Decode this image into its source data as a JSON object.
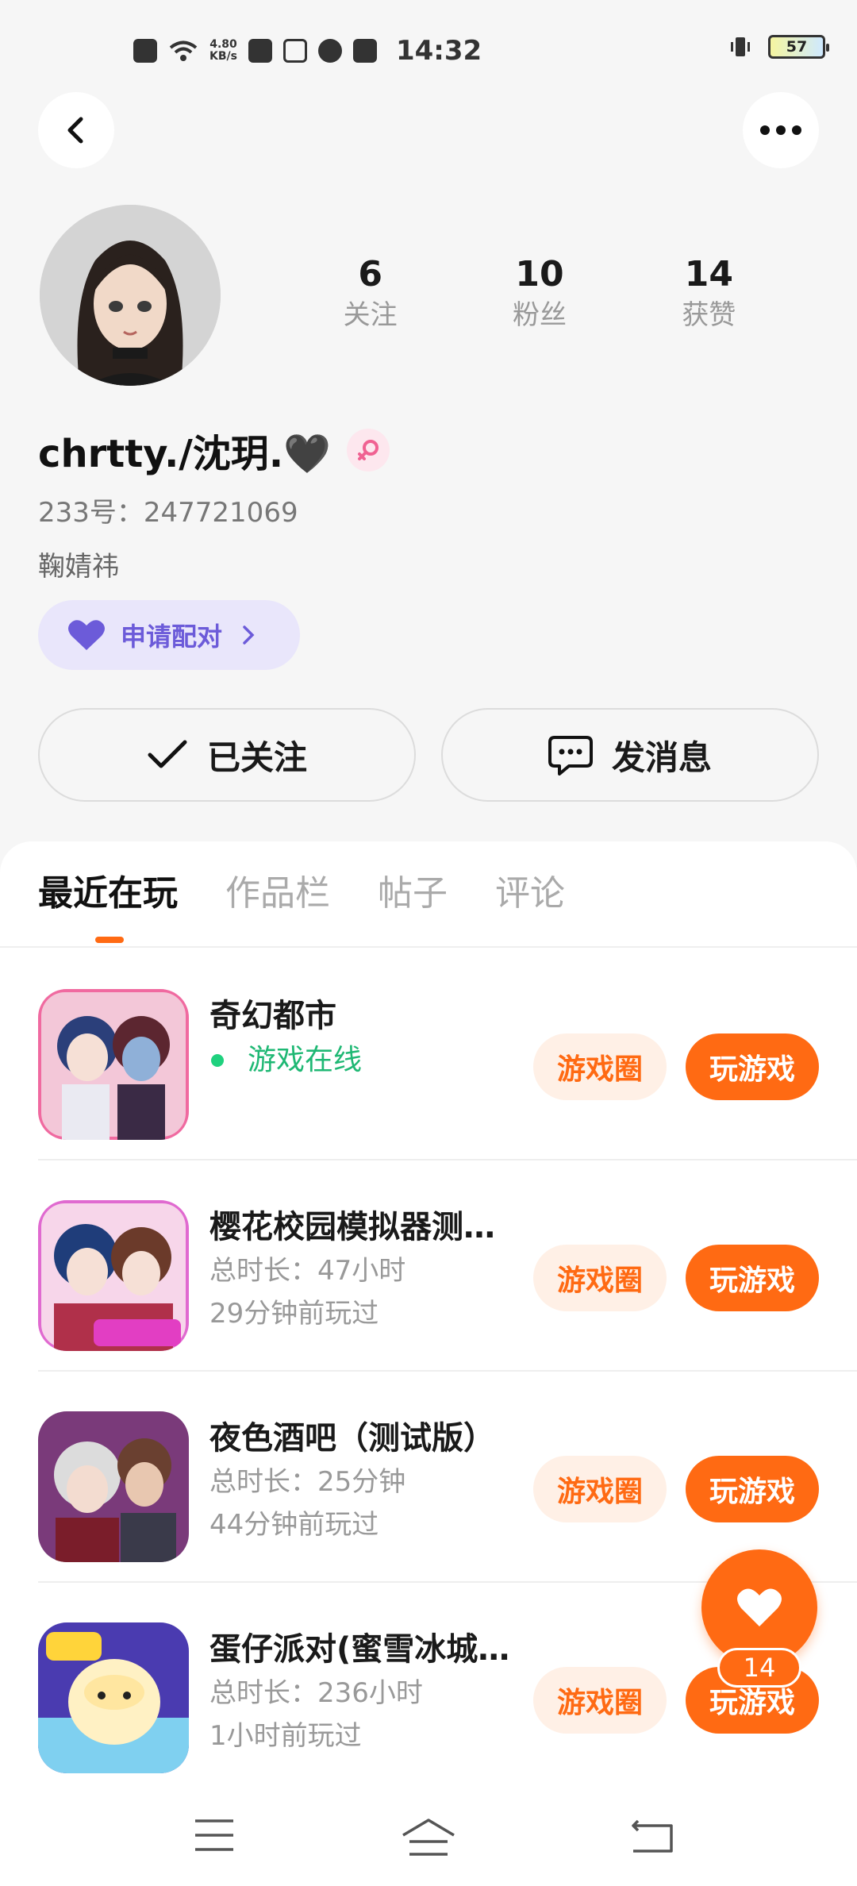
{
  "status_bar": {
    "speed_value": "4.80",
    "speed_unit": "KB/s",
    "time": "14:32",
    "battery": "57"
  },
  "profile": {
    "stats": [
      {
        "value": "6",
        "label": "关注"
      },
      {
        "value": "10",
        "label": "粉丝"
      },
      {
        "value": "14",
        "label": "获赞"
      }
    ],
    "username": "chrtty./沈玥.🖤",
    "uid": "233号：247721069",
    "bio": "鞠婧祎",
    "pair_label": "申请配对",
    "follow_label": "已关注",
    "message_label": "发消息"
  },
  "tabs": [
    {
      "label": "最近在玩",
      "active": true
    },
    {
      "label": "作品栏",
      "active": false
    },
    {
      "label": "帖子",
      "active": false
    },
    {
      "label": "评论",
      "active": false
    }
  ],
  "games": [
    {
      "title": "奇幻都市",
      "line1": "游戏在线",
      "line2": "",
      "online": true,
      "circle_label": "游戏圈",
      "play_label": "玩游戏"
    },
    {
      "title": "樱花校园模拟器测…",
      "line1": "总时长：47小时",
      "line2": "29分钟前玩过",
      "online": false,
      "circle_label": "游戏圈",
      "play_label": "玩游戏"
    },
    {
      "title": "夜色酒吧（测试版）",
      "line1": "总时长：25分钟",
      "line2": "44分钟前玩过",
      "online": false,
      "circle_label": "游戏圈",
      "play_label": "玩游戏"
    },
    {
      "title": "蛋仔派对(蜜雪冰城…",
      "line1": "总时长：236小时",
      "line2": "1小时前玩过",
      "online": false,
      "circle_label": "游戏圈",
      "play_label": "玩游戏"
    }
  ],
  "fab": {
    "count": "14"
  },
  "colors": {
    "accent": "#ff6a13",
    "online": "#1fb874",
    "pair": "#6c5bd9"
  }
}
